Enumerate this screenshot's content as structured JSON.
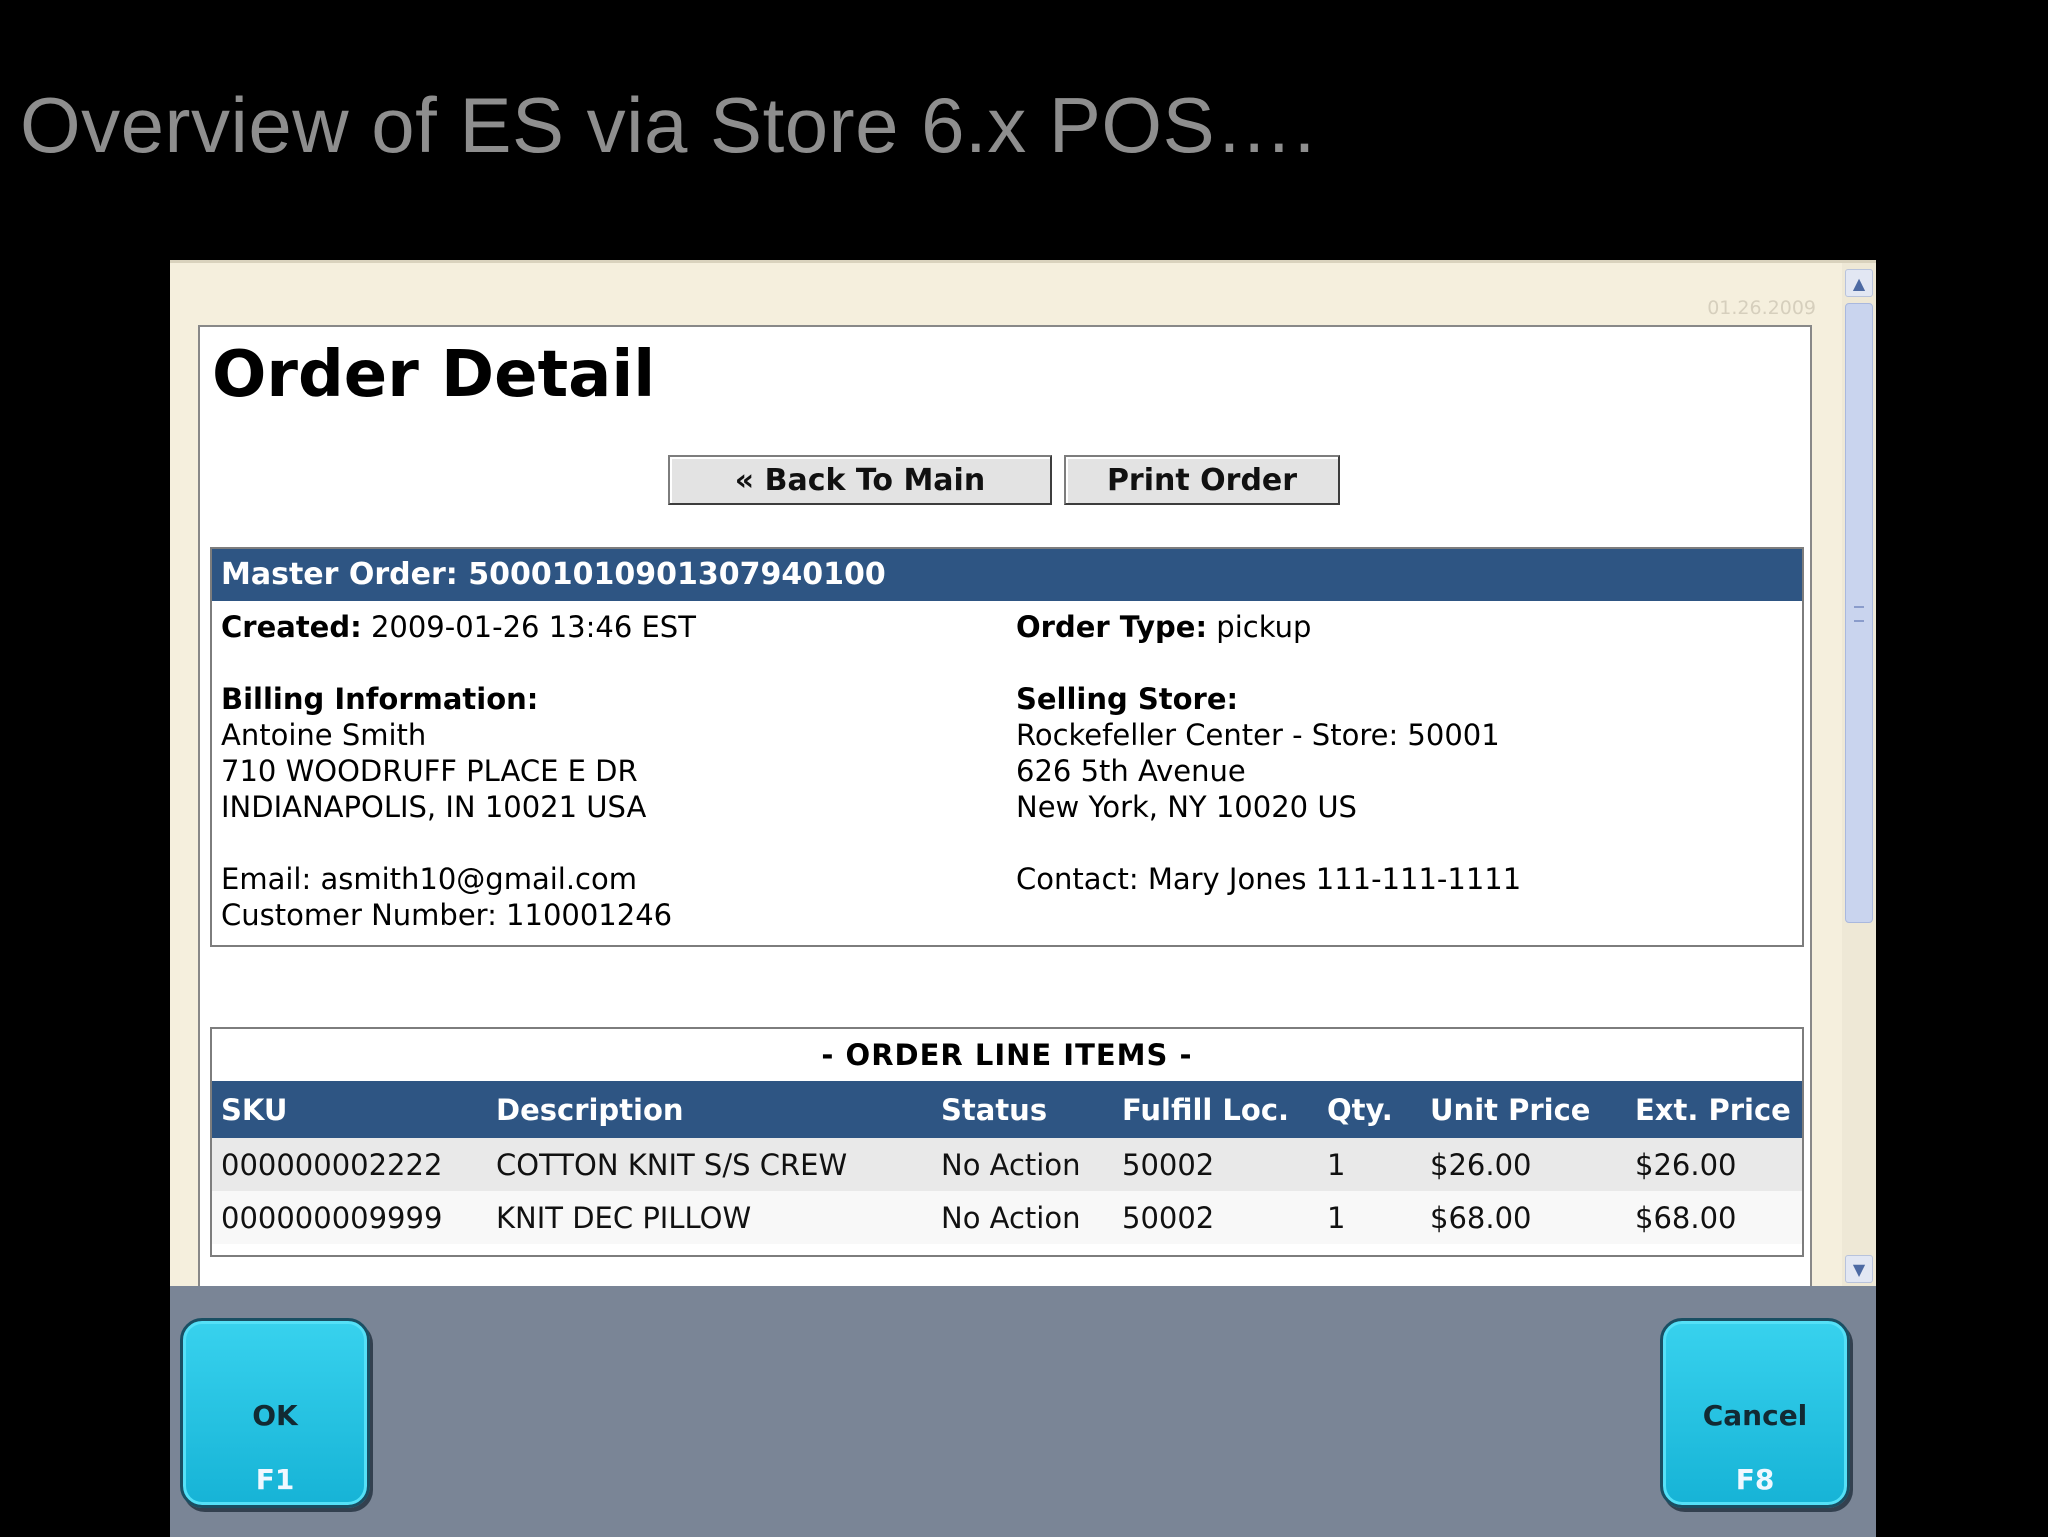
{
  "slide": {
    "title": "Overview of ES via Store 6.x POS…."
  },
  "browser": {
    "version": "01.26.2009"
  },
  "page": {
    "title": "Order Detail",
    "buttons": {
      "back": "« Back To Main",
      "print": "Print Order"
    }
  },
  "master": {
    "header": "Master Order: 50001010901307940100",
    "created_label": "Created:",
    "created_value": "2009-01-26 13:46 EST",
    "order_type_label": "Order Type:",
    "order_type_value": "pickup",
    "billing": {
      "heading": "Billing Information:",
      "name": "Antoine Smith",
      "address1": "710 WOODRUFF PLACE E DR",
      "address2": "INDIANAPOLIS, IN 10021 USA",
      "email": "Email: asmith10@gmail.com",
      "customer_number": "Customer Number: 110001246"
    },
    "store": {
      "heading": "Selling Store:",
      "name": "Rockefeller Center - Store: 50001",
      "address1": "626 5th Avenue",
      "address2": "New York, NY 10020 US",
      "contact": "Contact: Mary Jones 111-111-1111"
    }
  },
  "line_items": {
    "heading": "- ORDER LINE ITEMS -",
    "columns": [
      "SKU",
      "Description",
      "Status",
      "Fulfill Loc.",
      "Qty.",
      "Unit Price",
      "Ext. Price"
    ],
    "rows": [
      [
        "000000002222",
        "COTTON KNIT S/S CREW",
        "No Action",
        "50002",
        "1",
        "$26.00",
        "$26.00"
      ],
      [
        "000000009999",
        "KNIT DEC PILLOW",
        "No Action",
        "50002",
        "1",
        "$68.00",
        "$68.00"
      ]
    ]
  },
  "keys": {
    "ok": {
      "label": "OK",
      "key": "F1"
    },
    "cancel": {
      "label": "Cancel",
      "key": "F8"
    }
  }
}
